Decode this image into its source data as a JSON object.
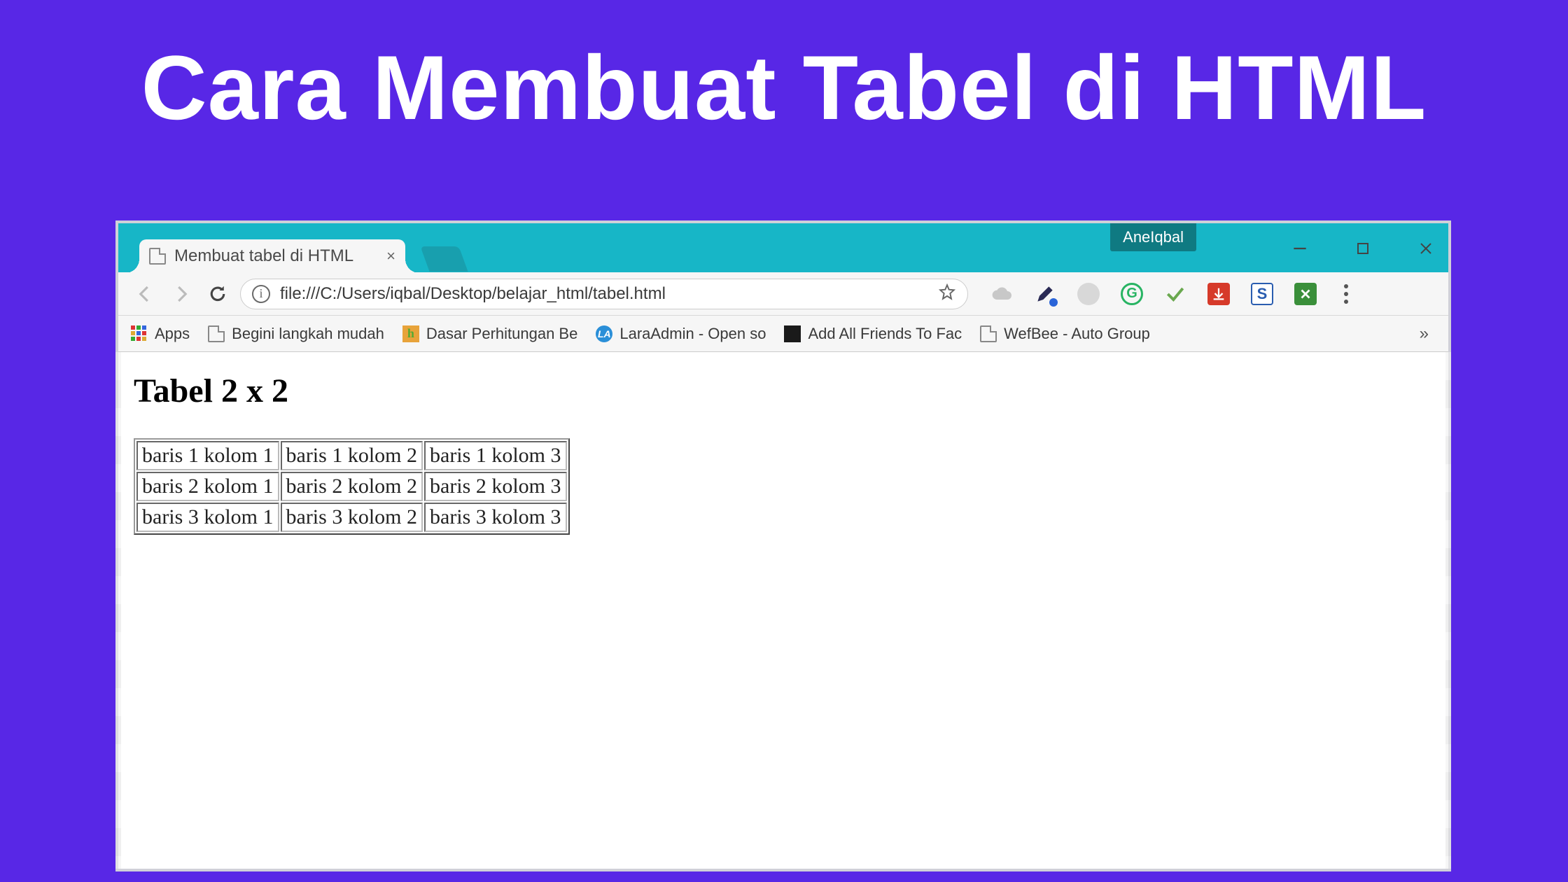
{
  "banner": {
    "title": "Cara Membuat Tabel di HTML"
  },
  "window": {
    "badge": "AneIqbal",
    "minimize": "—",
    "maximize": "▢",
    "close": "✕"
  },
  "tab": {
    "title": "Membuat tabel di HTML",
    "close": "×"
  },
  "address": {
    "url": "file:///C:/Users/iqbal/Desktop/belajar_html/tabel.html"
  },
  "bookmarks": {
    "apps": "Apps",
    "items": [
      "Begini langkah mudah",
      "Dasar Perhitungan Be",
      "LaraAdmin - Open so",
      "Add All Friends To Fac",
      "WefBee - Auto Group"
    ],
    "more": "»"
  },
  "page": {
    "heading": "Tabel 2 x 2",
    "table": [
      [
        "baris 1 kolom 1",
        "baris 1 kolom 2",
        "baris 1 kolom 3"
      ],
      [
        "baris 2 kolom 1",
        "baris 2 kolom 2",
        "baris 2 kolom 3"
      ],
      [
        "baris 3 kolom 1",
        "baris 3 kolom 2",
        "baris 3 kolom 3"
      ]
    ]
  }
}
